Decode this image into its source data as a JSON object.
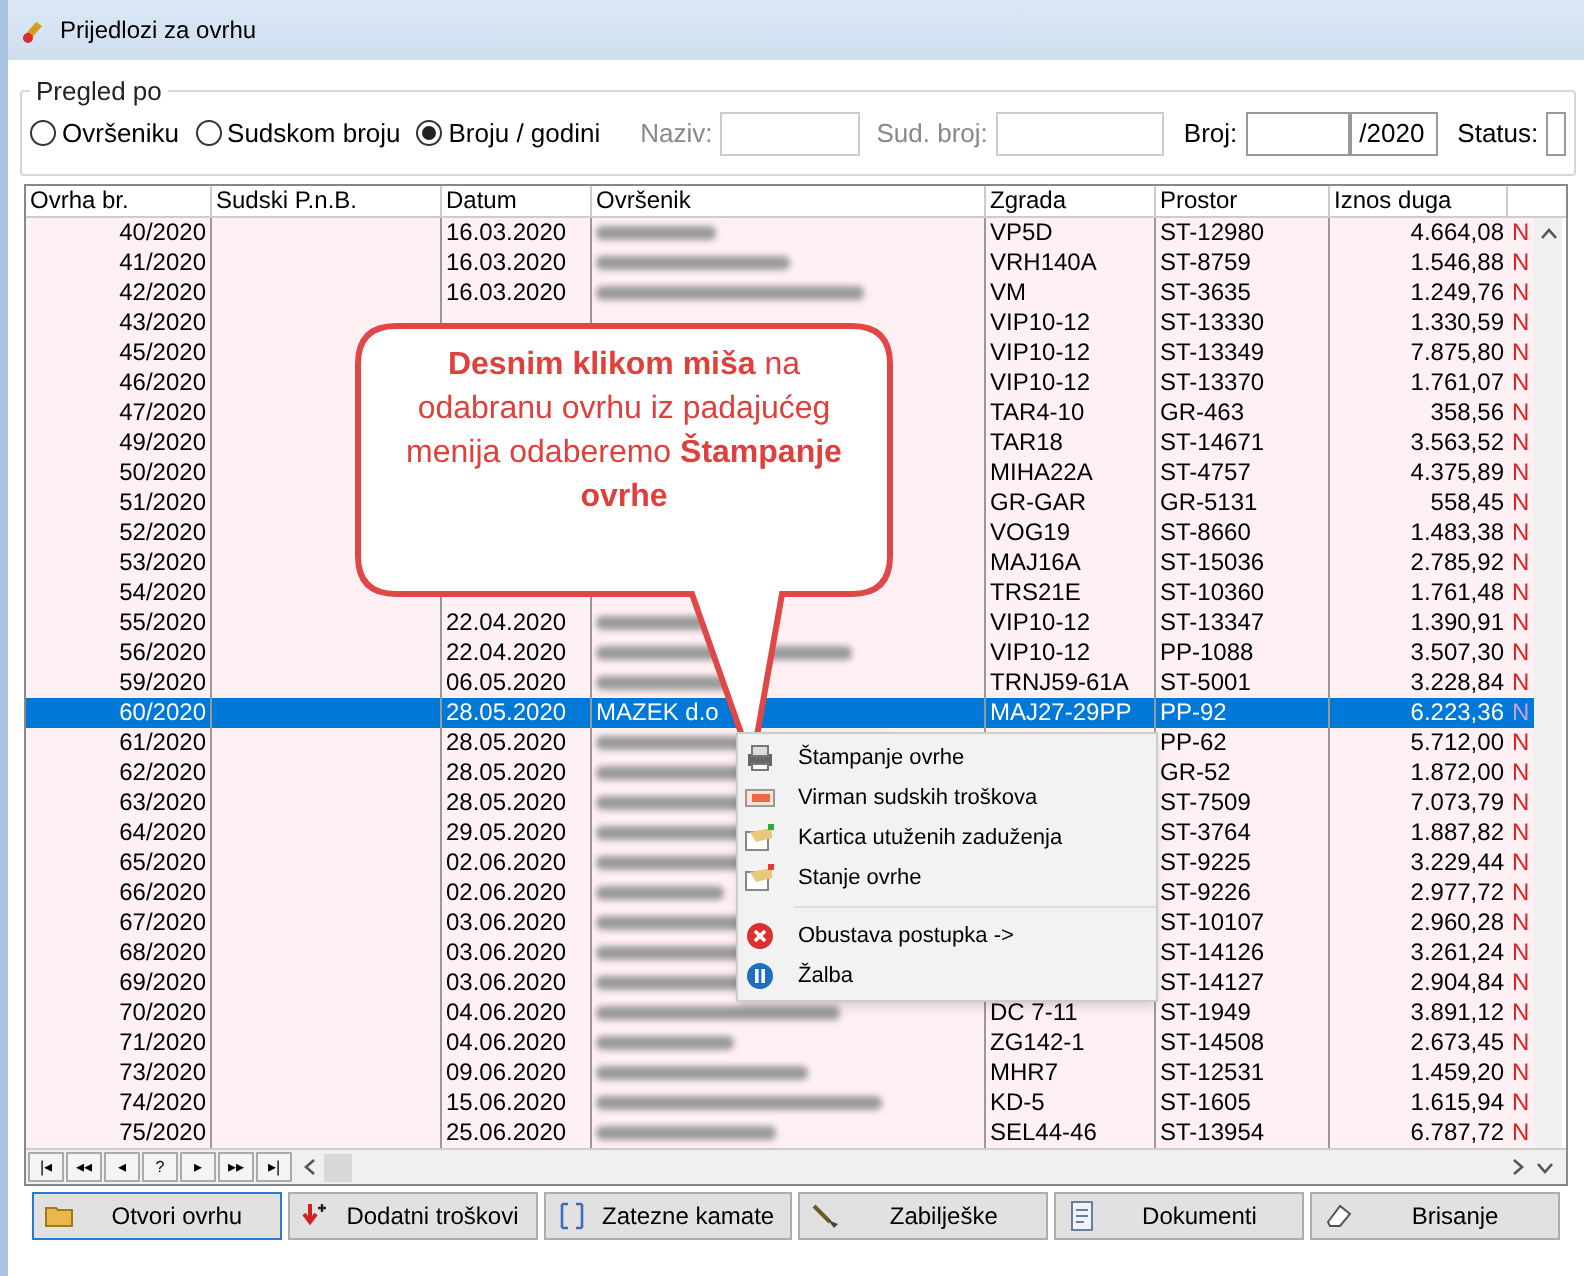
{
  "window": {
    "title": "Prijedlozi za ovrhu"
  },
  "filter": {
    "legend": "Pregled po",
    "options": [
      {
        "label": "Ovršeniku",
        "selected": false
      },
      {
        "label": "Sudskom broju",
        "selected": false
      },
      {
        "label": "Broju / godini",
        "selected": true
      }
    ],
    "fields": [
      {
        "label": "Naziv:",
        "disabled": true
      },
      {
        "label": "Sud. broj:",
        "disabled": true
      },
      {
        "label": "Broj:",
        "disabled": false,
        "suffix": "/2020"
      },
      {
        "label": "Status:",
        "disabled": false
      }
    ]
  },
  "table": {
    "columns": [
      "Ovrha br.",
      "Sudski P.n.B.",
      "Datum",
      "Ovršenik",
      "Zgrada",
      "Prostor",
      "Iznos duga"
    ],
    "rows": [
      {
        "ovrha": "40/2020",
        "datum": "16.03.2020",
        "ovrsenik_blurred": true,
        "zgrada": "VP5D",
        "prostor": "ST-12980",
        "iznos": "4.664,08",
        "flag": "N",
        "selected": false
      },
      {
        "ovrha": "41/2020",
        "datum": "16.03.2020",
        "ovrsenik_blurred": true,
        "zgrada": "VRH140A",
        "prostor": "ST-8759",
        "iznos": "1.546,88",
        "flag": "N",
        "selected": false
      },
      {
        "ovrha": "42/2020",
        "datum": "16.03.2020",
        "ovrsenik_blurred": true,
        "zgrada": "VM",
        "prostor": "ST-3635",
        "iznos": "1.249,76",
        "flag": "N",
        "selected": false
      },
      {
        "ovrha": "43/2020",
        "zgrada": "VIP10-12",
        "prostor": "ST-13330",
        "iznos": "1.330,59",
        "flag": "N",
        "selected": false
      },
      {
        "ovrha": "45/2020",
        "zgrada": "VIP10-12",
        "prostor": "ST-13349",
        "iznos": "7.875,80",
        "flag": "N",
        "selected": false
      },
      {
        "ovrha": "46/2020",
        "zgrada": "VIP10-12",
        "prostor": "ST-13370",
        "iznos": "1.761,07",
        "flag": "N",
        "selected": false
      },
      {
        "ovrha": "47/2020",
        "zgrada": "TAR4-10",
        "prostor": "GR-463",
        "iznos": "358,56",
        "flag": "N",
        "selected": false
      },
      {
        "ovrha": "49/2020",
        "zgrada": "TAR18",
        "prostor": "ST-14671",
        "iznos": "3.563,52",
        "flag": "N",
        "selected": false
      },
      {
        "ovrha": "50/2020",
        "zgrada": "MIHA22A",
        "prostor": "ST-4757",
        "iznos": "4.375,89",
        "flag": "N",
        "selected": false
      },
      {
        "ovrha": "51/2020",
        "zgrada": "GR-GAR",
        "prostor": "GR-5131",
        "iznos": "558,45",
        "flag": "N",
        "selected": false
      },
      {
        "ovrha": "52/2020",
        "zgrada": "VOG19",
        "prostor": "ST-8660",
        "iznos": "1.483,38",
        "flag": "N",
        "selected": false
      },
      {
        "ovrha": "53/2020",
        "zgrada": "MAJ16A",
        "prostor": "ST-15036",
        "iznos": "2.785,92",
        "flag": "N",
        "selected": false
      },
      {
        "ovrha": "54/2020",
        "zgrada": "TRS21E",
        "prostor": "ST-10360",
        "iznos": "1.761,48",
        "flag": "N",
        "selected": false
      },
      {
        "ovrha": "55/2020",
        "datum": "22.04.2020",
        "ovrsenik_blurred": true,
        "zgrada": "VIP10-12",
        "prostor": "ST-13347",
        "iznos": "1.390,91",
        "flag": "N",
        "selected": false
      },
      {
        "ovrha": "56/2020",
        "datum": "22.04.2020",
        "ovrsenik_blurred": true,
        "zgrada": "VIP10-12",
        "prostor": "PP-1088",
        "iznos": "3.507,30",
        "flag": "N",
        "selected": false
      },
      {
        "ovrha": "59/2020",
        "datum": "06.05.2020",
        "ovrsenik_blurred": true,
        "zgrada": "TRNJ59-61A",
        "prostor": "ST-5001",
        "iznos": "3.228,84",
        "flag": "N",
        "selected": false
      },
      {
        "ovrha": "60/2020",
        "datum": "28.05.2020",
        "ovrsenik": "MAZEK d.o",
        "zgrada": "MAJ27-29PP",
        "prostor": "PP-92",
        "iznos": "6.223,36",
        "flag": "N",
        "selected": true
      },
      {
        "ovrha": "61/2020",
        "datum": "28.05.2020",
        "ovrsenik_blurred": true,
        "prostor": "PP-62",
        "iznos": "5.712,00",
        "flag": "N",
        "selected": false
      },
      {
        "ovrha": "62/2020",
        "datum": "28.05.2020",
        "ovrsenik_blurred": true,
        "prostor": "GR-52",
        "iznos": "1.872,00",
        "flag": "N",
        "selected": false
      },
      {
        "ovrha": "63/2020",
        "datum": "28.05.2020",
        "ovrsenik_blurred": true,
        "prostor": "ST-7509",
        "iznos": "7.073,79",
        "flag": "N",
        "selected": false
      },
      {
        "ovrha": "64/2020",
        "datum": "29.05.2020",
        "ovrsenik_blurred": true,
        "prostor": "ST-3764",
        "iznos": "1.887,82",
        "flag": "N",
        "selected": false
      },
      {
        "ovrha": "65/2020",
        "datum": "02.06.2020",
        "ovrsenik_blurred": true,
        "prostor": "ST-9225",
        "iznos": "3.229,44",
        "flag": "N",
        "selected": false
      },
      {
        "ovrha": "66/2020",
        "datum": "02.06.2020",
        "ovrsenik_blurred": true,
        "prostor": "ST-9226",
        "iznos": "2.977,72",
        "flag": "N",
        "selected": false
      },
      {
        "ovrha": "67/2020",
        "datum": "03.06.2020",
        "ovrsenik_blurred": true,
        "prostor": "ST-10107",
        "iznos": "2.960,28",
        "flag": "N",
        "selected": false
      },
      {
        "ovrha": "68/2020",
        "datum": "03.06.2020",
        "ovrsenik_blurred": true,
        "prostor": "ST-14126",
        "iznos": "3.261,24",
        "flag": "N",
        "selected": false
      },
      {
        "ovrha": "69/2020",
        "datum": "03.06.2020",
        "ovrsenik_blurred": true,
        "prostor": "ST-14127",
        "iznos": "2.904,84",
        "flag": "N",
        "selected": false
      },
      {
        "ovrha": "70/2020",
        "datum": "04.06.2020",
        "ovrsenik_blurred": true,
        "zgrada": "DC 7-11",
        "prostor": "ST-1949",
        "iznos": "3.891,12",
        "flag": "N",
        "selected": false
      },
      {
        "ovrha": "71/2020",
        "datum": "04.06.2020",
        "ovrsenik_blurred": true,
        "zgrada": "ZG142-1",
        "prostor": "ST-14508",
        "iznos": "2.673,45",
        "flag": "N",
        "selected": false
      },
      {
        "ovrha": "73/2020",
        "datum": "09.06.2020",
        "ovrsenik_blurred": true,
        "zgrada": "MHR7",
        "prostor": "ST-12531",
        "iznos": "1.459,20",
        "flag": "N",
        "selected": false
      },
      {
        "ovrha": "74/2020",
        "datum": "15.06.2020",
        "ovrsenik_blurred": true,
        "zgrada": "KD-5",
        "prostor": "ST-1605",
        "iznos": "1.615,94",
        "flag": "N",
        "selected": false
      },
      {
        "ovrha": "75/2020",
        "datum": "25.06.2020",
        "ovrsenik_blurred": true,
        "zgrada": "SEL44-46",
        "prostor": "ST-13954",
        "iznos": "6.787,72",
        "flag": "N",
        "selected": false
      }
    ]
  },
  "navigator": [
    "|◂",
    "◂◂",
    "◂",
    "?",
    "▸",
    "▸▸",
    "▸|"
  ],
  "context_menu": [
    {
      "kind": "printer",
      "label": "Štampanje ovrhe"
    },
    {
      "kind": "slip",
      "label": "Virman sudskih troškova"
    },
    {
      "kind": "card-green",
      "label": "Kartica utuženih zaduženja"
    },
    {
      "kind": "card-red",
      "label": "Stanje ovrhe"
    },
    {
      "kind": "separator"
    },
    {
      "kind": "cancel",
      "label": "Obustava postupka ->"
    },
    {
      "kind": "pause",
      "label": "Žalba"
    }
  ],
  "callout": {
    "text": "**Desnim klikom miša** na odabranu ovrhu iz padajućeg menija odaberemo **Štampanje ovrhe**"
  },
  "buttons": [
    {
      "label": "Otvori ovrhu",
      "selected": true
    },
    {
      "label": "Dodatni troškovi",
      "selected": false
    },
    {
      "label": "Zatezne kamate",
      "selected": false
    },
    {
      "label": "Zabilješke",
      "selected": false
    },
    {
      "label": "Dokumenti",
      "selected": false
    },
    {
      "label": "Brisanje",
      "selected": false
    }
  ]
}
